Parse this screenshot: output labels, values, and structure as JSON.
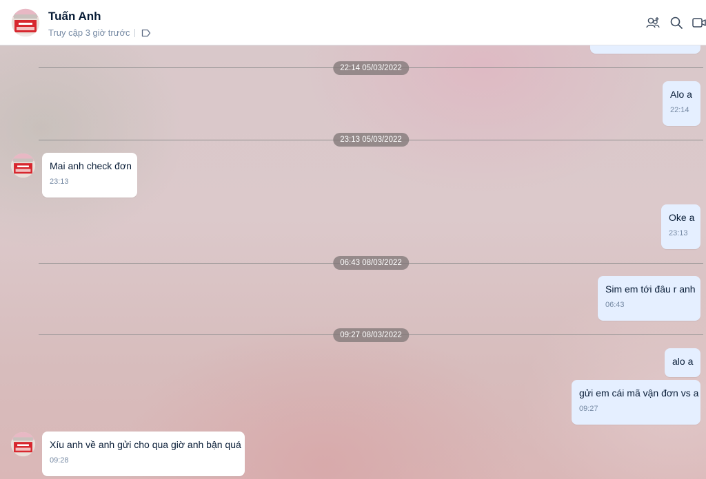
{
  "header": {
    "contact_name": "Tuấn Anh",
    "status": "Truy cập 3 giờ trước",
    "icons": [
      "add-member-icon",
      "search-icon",
      "video-call-icon",
      "tag-icon"
    ]
  },
  "messages": [
    {
      "date": "22:14 05/03/2022"
    },
    {
      "side": "me",
      "text": "Alo a",
      "time": "22:14"
    },
    {
      "date": "23:13 05/03/2022"
    },
    {
      "side": "other",
      "text": "Mai anh check đơn",
      "time": "23:13"
    },
    {
      "side": "me",
      "text": "Oke a",
      "time": "23:13"
    },
    {
      "date": "06:43 08/03/2022"
    },
    {
      "side": "me",
      "text": "Sim em tới đâu r anh",
      "time": "06:43"
    },
    {
      "date": "09:27 08/03/2022"
    },
    {
      "side": "me",
      "text": "alo a"
    },
    {
      "side": "me",
      "text": "gửi em cái mã vận đơn vs a",
      "time": "09:27"
    },
    {
      "side": "other",
      "text": "Xíu anh về anh gửi cho qua giờ anh bận quá",
      "time": "09:28"
    }
  ],
  "colors": {
    "my_bubble": "#e5efff",
    "other_bubble": "#ffffff",
    "name": "#081c36",
    "muted": "#7589a3"
  }
}
